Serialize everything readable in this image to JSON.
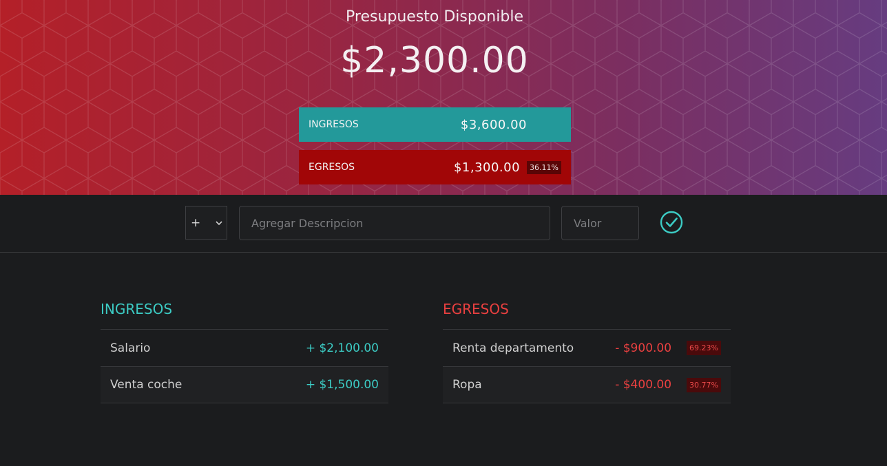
{
  "header": {
    "title": "Presupuesto Disponible",
    "total": "$2,300.00",
    "income_label": "INGRESOS",
    "income_value": "$3,600.00",
    "expense_label": "EGRESOS",
    "expense_value": "$1,300.00",
    "expense_percent": "36.11%"
  },
  "form": {
    "type_value": "+",
    "description_placeholder": "Agregar Descripcion",
    "value_placeholder": "Valor",
    "submit_icon": "check-circle-icon"
  },
  "incomes": {
    "title": "INGRESOS",
    "items": [
      {
        "description": "Salario",
        "amount": "+ $2,100.00"
      },
      {
        "description": "Venta coche",
        "amount": "+ $1,500.00"
      }
    ]
  },
  "expenses": {
    "title": "EGRESOS",
    "items": [
      {
        "description": "Renta departamento",
        "amount": "- $900.00",
        "percent": "69.23%"
      },
      {
        "description": "Ropa",
        "amount": "- $400.00",
        "percent": "30.77%"
      }
    ]
  },
  "colors": {
    "income": "#3ccbc4",
    "expense": "#ea4040",
    "income_box": "#23999a",
    "expense_box": "#a10607",
    "background": "#1b1c1e"
  }
}
